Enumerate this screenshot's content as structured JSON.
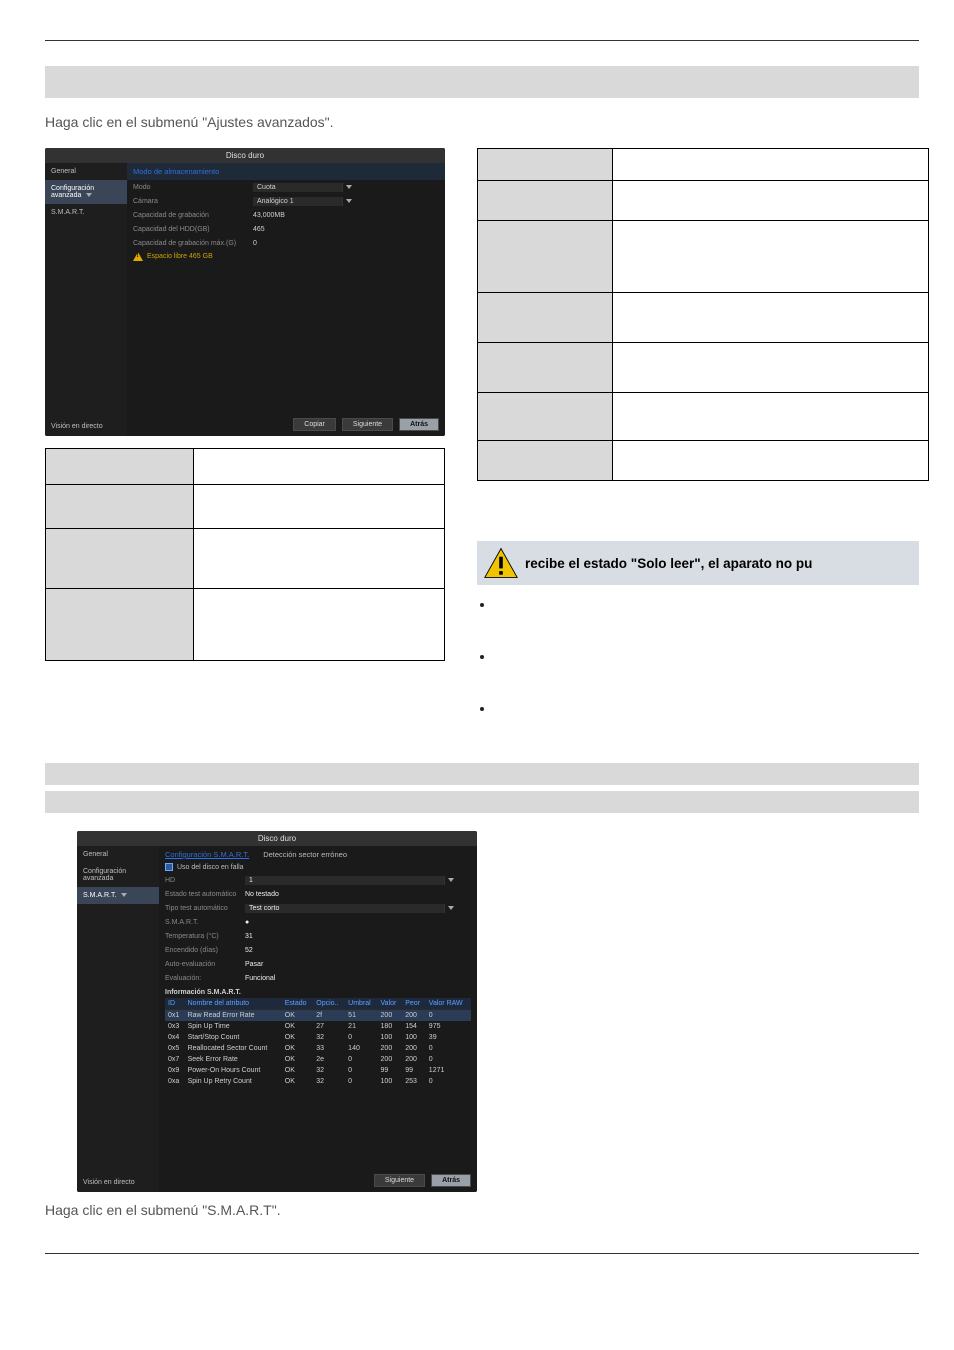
{
  "intro1": "Haga clic en el submenú \"Ajustes avanzados\".",
  "intro2": "Haga clic en el submenú \"S.M.A.R.T\".",
  "warn_block_text": "recibe el estado \"Solo leer\", el aparato no pu",
  "app1": {
    "title": "Disco duro",
    "sidebar": {
      "items": [
        "General",
        "Configuración avanzada",
        "S.M.A.R.T."
      ],
      "footer": "Visión en directo",
      "active_index": 1
    },
    "mode_header": "Modo de almacenamiento",
    "rows": [
      {
        "label": "Modo",
        "value": "Cuota",
        "dropdown": true
      },
      {
        "label": "Cámara",
        "value": "Analógico 1",
        "dropdown": true
      },
      {
        "label": "Capacidad de grabación",
        "value": "43,000MB"
      },
      {
        "label": "Capacidad del HDD(GB)",
        "value": "465"
      },
      {
        "label": "Capacidad de grabación máx.(G)",
        "value": "0"
      }
    ],
    "warn": "Espacio libre 465 GB",
    "buttons": {
      "copy": "Copiar",
      "save": "Siguiente",
      "back": "Atrás"
    }
  },
  "left_table": {
    "rows": [
      {
        "h": "h36"
      },
      {
        "h": "h44"
      },
      {
        "h": "h60"
      },
      {
        "h": "h72"
      }
    ]
  },
  "right_table": {
    "rows": [
      {
        "h": "h32"
      },
      {
        "h": "h40"
      },
      {
        "h": "h72"
      },
      {
        "h": "h50"
      },
      {
        "h": "h50"
      },
      {
        "h": "h48"
      },
      {
        "h": "h40"
      }
    ]
  },
  "app2": {
    "title": "Disco duro",
    "sidebar": {
      "items": [
        "General",
        "Configuración avanzada",
        "S.M.A.R.T."
      ],
      "footer": "Visión en directo",
      "active_index": 2
    },
    "tabs": {
      "t1": "Configuración S.M.A.R.T.",
      "t2": "Detección sector erróneo"
    },
    "chk_label": "Uso del disco en falla",
    "kv": [
      {
        "label": "HD",
        "value": "1",
        "dropdown": true
      },
      {
        "label": "Estado test automático",
        "value": "No testado"
      },
      {
        "label": "Tipo test automático",
        "value": "Test corto",
        "dropdown": true
      },
      {
        "label": "S.M.A.R.T.",
        "value": "●"
      },
      {
        "label": "Temperatura (°C)",
        "value": "31"
      },
      {
        "label": "Encendido (días)",
        "value": "52"
      },
      {
        "label": "Auto-evaluación",
        "value": "Pasar"
      },
      {
        "label": "Evaluación:",
        "value": "Funcional"
      }
    ],
    "info_header": "Información S.M.A.R.T.",
    "columns": [
      "ID",
      "Nombre del atributo",
      "Estado",
      "Opcio..",
      "Umbral",
      "Valor",
      "Peor",
      "Valor RAW"
    ],
    "rows": [
      [
        "0x1",
        "Raw Read Error Rate",
        "OK",
        "2f",
        "51",
        "200",
        "200",
        "0"
      ],
      [
        "0x3",
        "Spin Up Time",
        "OK",
        "27",
        "21",
        "180",
        "154",
        "975"
      ],
      [
        "0x4",
        "Start/Stop Count",
        "OK",
        "32",
        "0",
        "100",
        "100",
        "39"
      ],
      [
        "0x5",
        "Reallocated Sector Count",
        "OK",
        "33",
        "140",
        "200",
        "200",
        "0"
      ],
      [
        "0x7",
        "Seek Error Rate",
        "OK",
        "2e",
        "0",
        "200",
        "200",
        "0"
      ],
      [
        "0x9",
        "Power-On Hours Count",
        "OK",
        "32",
        "0",
        "99",
        "99",
        "1271"
      ],
      [
        "0xa",
        "Spin Up Retry Count",
        "OK",
        "32",
        "0",
        "100",
        "253",
        "0"
      ]
    ],
    "buttons": {
      "save": "Siguiente",
      "back": "Atrás"
    }
  },
  "chart_data": {
    "type": "table",
    "title": "Información S.M.A.R.T.",
    "columns": [
      "ID",
      "Nombre del atributo",
      "Estado",
      "Opcio..",
      "Umbral",
      "Valor",
      "Peor",
      "Valor RAW"
    ],
    "rows": [
      [
        "0x1",
        "Raw Read Error Rate",
        "OK",
        "2f",
        51,
        200,
        200,
        0
      ],
      [
        "0x3",
        "Spin Up Time",
        "OK",
        "27",
        21,
        180,
        154,
        975
      ],
      [
        "0x4",
        "Start/Stop Count",
        "OK",
        "32",
        0,
        100,
        100,
        39
      ],
      [
        "0x5",
        "Reallocated Sector Count",
        "OK",
        "33",
        140,
        200,
        200,
        0
      ],
      [
        "0x7",
        "Seek Error Rate",
        "OK",
        "2e",
        0,
        200,
        200,
        0
      ],
      [
        "0x9",
        "Power-On Hours Count",
        "OK",
        "32",
        0,
        99,
        99,
        1271
      ],
      [
        "0xa",
        "Spin Up Retry Count",
        "OK",
        "32",
        0,
        100,
        253,
        0
      ]
    ]
  }
}
